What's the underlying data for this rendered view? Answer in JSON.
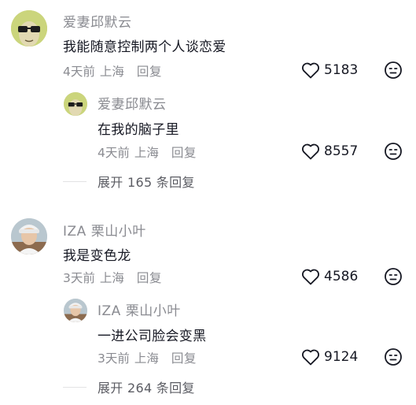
{
  "threads": [
    {
      "comment": {
        "username": "爱妻邱默云",
        "text": "我能随意控制两个人谈恋爱",
        "time": "4天前",
        "location": "上海",
        "reply_label": "回复",
        "likes": "5183"
      },
      "reply": {
        "username": "爱妻邱默云",
        "text": "在我的脑子里",
        "time": "4天前",
        "location": "上海",
        "reply_label": "回复",
        "likes": "8557"
      },
      "expand_label": "展开 165 条回复"
    },
    {
      "comment": {
        "username": "IZA 栗山小叶",
        "text": "我是变色龙",
        "time": "3天前",
        "location": "上海",
        "reply_label": "回复",
        "likes": "4586"
      },
      "reply": {
        "username": "IZA 栗山小叶",
        "text": "一进公司脸会变黑",
        "time": "3天前",
        "location": "上海",
        "reply_label": "回复",
        "likes": "9124"
      },
      "expand_label": "展开 264 条回复"
    }
  ],
  "icons": {
    "like": "heart-outline-icon",
    "dislike": "neutral-face-icon"
  },
  "colors": {
    "text_primary": "#161823",
    "text_secondary": "#8a8b91",
    "expand_text": "#5b5c63"
  }
}
